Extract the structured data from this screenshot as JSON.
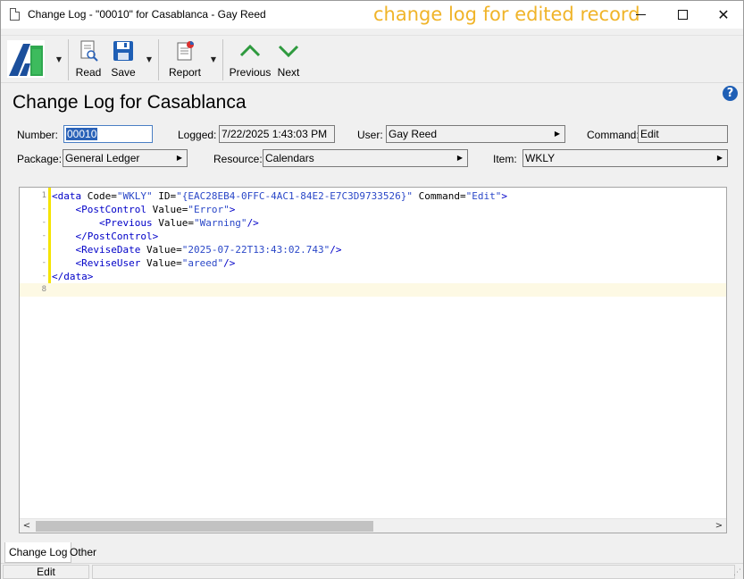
{
  "window": {
    "title": "Change Log - \"00010\" for Casablanca - Gay Reed",
    "annotation": "change log for edited record"
  },
  "toolbar": {
    "read_label": "Read",
    "save_label": "Save",
    "report_label": "Report",
    "previous_label": "Previous",
    "next_label": "Next"
  },
  "header": {
    "title": "Change Log for Casablanca"
  },
  "fields": {
    "number_label": "Number:",
    "number_value": "00010",
    "logged_label": "Logged:",
    "logged_value": "7/22/2025 1:43:03 PM",
    "user_label": "User:",
    "user_value": "Gay Reed",
    "command_label": "Command:",
    "command_value": "Edit",
    "package_label": "Package:",
    "package_value": "General Ledger",
    "resource_label": "Resource:",
    "resource_value": "Calendars",
    "item_label": "Item:",
    "item_value": "WKLY"
  },
  "editor": {
    "lines": [
      {
        "num": "1",
        "parts": [
          [
            "t",
            "<data"
          ],
          [
            "a",
            " Code="
          ],
          [
            "v",
            "\"WKLY\""
          ],
          [
            "a",
            " ID="
          ],
          [
            "v",
            "\"{EAC28EB4-0FFC-4AC1-84E2-E7C3D9733526}\""
          ],
          [
            "a",
            " Command="
          ],
          [
            "v",
            "\"Edit\""
          ],
          [
            "t",
            ">"
          ]
        ]
      },
      {
        "num": "-",
        "parts": [
          [
            "a",
            "    "
          ],
          [
            "t",
            "<PostControl"
          ],
          [
            "a",
            " Value="
          ],
          [
            "v",
            "\"Error\""
          ],
          [
            "t",
            ">"
          ]
        ]
      },
      {
        "num": "-",
        "parts": [
          [
            "a",
            "        "
          ],
          [
            "t",
            "<Previous"
          ],
          [
            "a",
            " Value="
          ],
          [
            "v",
            "\"Warning\""
          ],
          [
            "t",
            "/>"
          ]
        ]
      },
      {
        "num": "-",
        "parts": [
          [
            "a",
            "    "
          ],
          [
            "t",
            "</PostControl>"
          ]
        ]
      },
      {
        "num": "-",
        "parts": [
          [
            "a",
            "    "
          ],
          [
            "t",
            "<ReviseDate"
          ],
          [
            "a",
            " Value="
          ],
          [
            "v",
            "\"2025-07-22T13:43:02.743\""
          ],
          [
            "t",
            "/>"
          ]
        ]
      },
      {
        "num": "-",
        "parts": [
          [
            "a",
            "    "
          ],
          [
            "t",
            "<ReviseUser"
          ],
          [
            "a",
            " Value="
          ],
          [
            "v",
            "\"areed\""
          ],
          [
            "t",
            "/>"
          ]
        ]
      },
      {
        "num": "-",
        "parts": [
          [
            "t",
            "</data>"
          ]
        ]
      },
      {
        "num": "8",
        "parts": []
      }
    ]
  },
  "tabs": {
    "change_log": "Change Log",
    "other": "Other"
  },
  "status": {
    "mode": "Edit"
  }
}
